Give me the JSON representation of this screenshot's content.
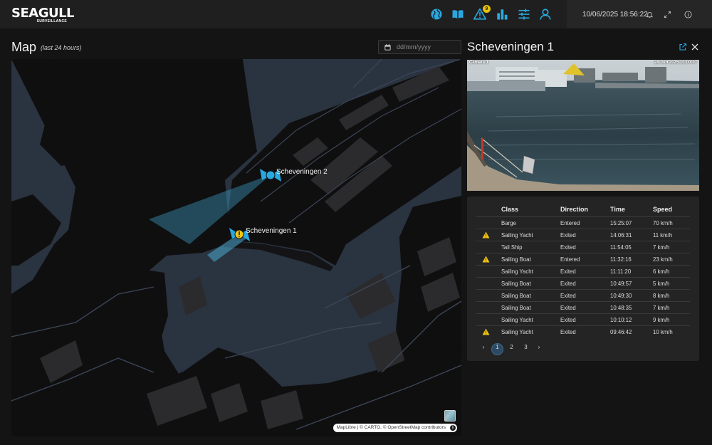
{
  "brand": {
    "name": "SEAGULL",
    "tagline": "SURVEILLANCE"
  },
  "header": {
    "nav": [
      {
        "name": "globe-icon"
      },
      {
        "name": "book-icon"
      },
      {
        "name": "alert-icon",
        "badge": "9"
      },
      {
        "name": "bar-chart-icon"
      },
      {
        "name": "sliders-icon"
      },
      {
        "name": "user-icon"
      }
    ],
    "datetime": "10/06/2025 18:56:22",
    "accent": "#29a8e0"
  },
  "map": {
    "title": "Map",
    "subtitle": "(last 24 hours)",
    "date_placeholder": "dd/mm/yyyy",
    "cameras": [
      {
        "label": "Scheveningen 2",
        "alert": false
      },
      {
        "label": "Scheveningen 1",
        "alert": true
      }
    ],
    "attribution": "MapLibre | © CARTO, © OpenStreetMap contributors"
  },
  "panel": {
    "title": "Scheveningen 1",
    "camera_overlay_left": "Camera 1",
    "camera_overlay_right": "28-Jun 2025  10:00:07",
    "columns": [
      "Class",
      "Direction",
      "Time",
      "Speed"
    ],
    "rows": [
      {
        "alert": false,
        "class": "Barge",
        "direction": "Entered",
        "time": "15:25:07",
        "speed": "70 km/h"
      },
      {
        "alert": true,
        "class": "Sailing Yacht",
        "direction": "Exited",
        "time": "14:06:31",
        "speed": "11 km/h"
      },
      {
        "alert": false,
        "class": "Tall Ship",
        "direction": "Exited",
        "time": "11:54:05",
        "speed": "7 km/h"
      },
      {
        "alert": true,
        "class": "Sailing Boat",
        "direction": "Entered",
        "time": "11:32:16",
        "speed": "23 km/h"
      },
      {
        "alert": false,
        "class": "Sailing Yacht",
        "direction": "Exited",
        "time": "11:11:20",
        "speed": "6 km/h"
      },
      {
        "alert": false,
        "class": "Sailing Boat",
        "direction": "Exited",
        "time": "10:49:57",
        "speed": "5 km/h"
      },
      {
        "alert": false,
        "class": "Sailing Boat",
        "direction": "Exited",
        "time": "10:49:30",
        "speed": "8 km/h"
      },
      {
        "alert": false,
        "class": "Sailing Boat",
        "direction": "Exited",
        "time": "10:48:35",
        "speed": "7 km/h"
      },
      {
        "alert": false,
        "class": "Sailing Yacht",
        "direction": "Exited",
        "time": "10:10:12",
        "speed": "9 km/h"
      },
      {
        "alert": true,
        "class": "Sailing Yacht",
        "direction": "Exited",
        "time": "09:46:42",
        "speed": "10 km/h"
      }
    ],
    "pagination": {
      "prev": "‹",
      "pages": [
        "1",
        "2",
        "3"
      ],
      "next": "›",
      "current": "1"
    }
  },
  "colors": {
    "warning": "#f2c511",
    "water": "#2a3340",
    "land": "#0f0f10"
  }
}
